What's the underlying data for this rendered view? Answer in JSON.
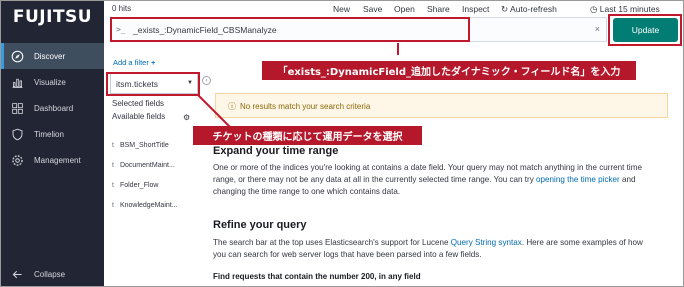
{
  "sidebar": {
    "logo": "FUJITSU",
    "items": [
      {
        "label": "Discover",
        "icon": "compass-icon",
        "active": true
      },
      {
        "label": "Visualize",
        "icon": "bar-chart-icon"
      },
      {
        "label": "Dashboard",
        "icon": "dashboard-icon"
      },
      {
        "label": "Timelion",
        "icon": "shield-icon"
      },
      {
        "label": "Management",
        "icon": "gear-icon"
      }
    ],
    "collapse": "Collapse"
  },
  "topbar": {
    "hits": "0 hits",
    "menu": [
      "New",
      "Save",
      "Open",
      "Share",
      "Inspect"
    ],
    "auto_refresh": "Auto-refresh",
    "time_range": "Last 15 minutes"
  },
  "query": {
    "prompt": ">_",
    "value": "_exists_:DynamicField_CBSManalyze",
    "clear": "×",
    "update": "Update"
  },
  "left_panel": {
    "add_filter": "Add a filter",
    "index": "itsm.tickets",
    "selected_fields": "Selected fields",
    "available_fields": "Available fields",
    "fields": [
      {
        "type": "t",
        "name": "BSM_ShortTitle"
      },
      {
        "type": "t",
        "name": "DocumentMaint..."
      },
      {
        "type": "t",
        "name": "Folder_Flow"
      },
      {
        "type": "t",
        "name": "KnowledgeMaint..."
      }
    ]
  },
  "main": {
    "callout": "No results match your search criteria",
    "expand_title": "Expand your time range",
    "expand_line1": "One or more of the indices you're looking at contains a date field. Your query may not match anything in the current time",
    "expand_line2_pre": "range, or there may not be any data at all in the currently selected time range. You can try ",
    "expand_link": "opening the time picker",
    "expand_line2_post": " and",
    "expand_line3": "changing the time range to one which contains data.",
    "refine_title": "Refine your query",
    "refine_line1_pre": "The search bar at the top uses Elasticsearch's support for Lucene ",
    "refine_link": "Query String syntax",
    "refine_line1_post": ". Here are some examples of how",
    "refine_line2": "you can search for web server logs that have been parsed into a few fields.",
    "find_title": "Find requests that contain the number 200, in any field"
  },
  "annotations": {
    "query_note": "「exists_:DynamicField_追加したダイナミック・フィールド名」を入力",
    "index_note": "チケットの種類に応じて運用データを選択"
  },
  "colors": {
    "sidebar_bg": "#222533",
    "update_btn": "#017d73",
    "annotation_red": "#c0182c",
    "link": "#006bb4",
    "callout_bg": "#fef6e6"
  }
}
